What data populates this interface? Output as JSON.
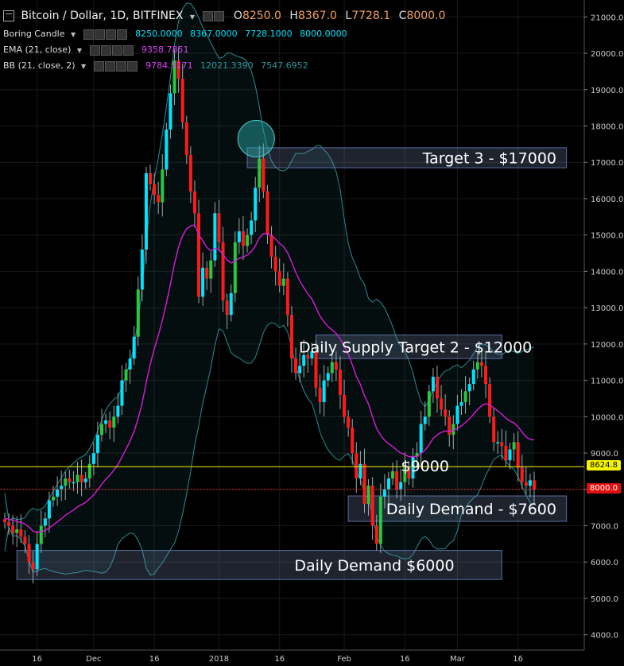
{
  "header": {
    "symbol": "Bitcoin / Dollar, 1D, BITFINEX",
    "o_label": "O",
    "o": "8250.0",
    "h_label": "H",
    "h": "8367.0",
    "l_label": "L",
    "l": "7728.1",
    "c_label": "C",
    "c": "8000.0"
  },
  "indicators": [
    {
      "name": "Boring Candle",
      "values": [
        "8250.0000",
        "8367.0000",
        "7728.1000",
        "8000.0000"
      ],
      "color": "#00e5ff"
    },
    {
      "name": "EMA (21, close)",
      "values": [
        "9358.7851"
      ],
      "color": "#e040fb"
    },
    {
      "name": "BB (21, close, 2)",
      "values": [
        "9784.5171",
        "12021.3390",
        "7547.6952"
      ],
      "colors": [
        "#e040fb",
        "#2a9aa0",
        "#2a9aa0"
      ]
    }
  ],
  "price_labels": {
    "hline": "8624.8",
    "last": "8000.0"
  },
  "colors": {
    "up": "#00e5ff",
    "up_alt": "#26c940",
    "down": "#ff1a1a",
    "ema": "#d81bd8",
    "bb": "#2a8a90",
    "hline": "#f5f500",
    "box": "#5a6ea0"
  },
  "chart_data": {
    "type": "candlestick",
    "title": "Bitcoin / Dollar, 1D, BITFINEX",
    "ylim": [
      3600,
      21400
    ],
    "yticks": [
      4000,
      5000,
      6000,
      7000,
      8000,
      9000,
      10000,
      11000,
      12000,
      13000,
      14000,
      15000,
      16000,
      17000,
      18000,
      19000,
      20000,
      21000
    ],
    "ytick_labels": [
      "4000.0",
      "5000.0",
      "6000.0",
      "7000.0",
      "8000.0",
      "9000.0",
      "10000.0",
      "11000.0",
      "12000.0",
      "13000.0",
      "14000.0",
      "15000.0",
      "16000.0",
      "17000.0",
      "18000.0",
      "19000.0",
      "20000.0",
      "21000.0"
    ],
    "xticks": [
      {
        "label": "16",
        "bar": 8
      },
      {
        "label": "Dec",
        "bar": 22
      },
      {
        "label": "16",
        "bar": 37
      },
      {
        "label": "2018",
        "bar": 53
      },
      {
        "label": "16",
        "bar": 68
      },
      {
        "label": "Feb",
        "bar": 84
      },
      {
        "label": "16",
        "bar": 99
      },
      {
        "label": "Mar",
        "bar": 112
      },
      {
        "label": "16",
        "bar": 127
      }
    ],
    "series_close": [
      7100,
      7000,
      6800,
      6900,
      6700,
      6500,
      6000,
      5800,
      6500,
      7000,
      7200,
      7700,
      7800,
      8000,
      8100,
      8300,
      8200,
      8200,
      8400,
      8200,
      8300,
      8700,
      9000,
      9500,
      9800,
      9900,
      9700,
      10000,
      10300,
      11000,
      11300,
      11600,
      12200,
      13500,
      14600,
      16700,
      16400,
      16100,
      15900,
      16800,
      17900,
      18900,
      19800,
      19300,
      18100,
      17200,
      16200,
      15600,
      13300,
      14100,
      13800,
      14300,
      15600,
      14800,
      13200,
      12800,
      13400,
      14800,
      15100,
      14700,
      15000,
      15400,
      16300,
      17100,
      16200,
      15000,
      14400,
      14000,
      13600,
      13800,
      12800,
      11600,
      11200,
      11400,
      11700,
      11600,
      11800,
      10800,
      10400,
      11000,
      11200,
      11500,
      11300,
      10600,
      10000,
      9700,
      9000,
      8300,
      8700,
      7600,
      8100,
      7000,
      6500,
      7800,
      8000,
      8300,
      8500,
      8000,
      8200,
      8600,
      8300,
      8900,
      9000,
      9800,
      10000,
      10700,
      11100,
      10500,
      10200,
      10000,
      9500,
      9800,
      10300,
      10400,
      10700,
      10900,
      11300,
      11500,
      11400,
      10900,
      10000,
      9300,
      9300,
      9200,
      8800,
      9100,
      9300,
      8600,
      8200,
      8100,
      8250,
      8000
    ],
    "ema": [
      7200,
      7180,
      7150,
      7120,
      7090,
      7050,
      6960,
      6850,
      6820,
      6840,
      6870,
      6940,
      7020,
      7110,
      7190,
      7290,
      7360,
      7430,
      7520,
      7580,
      7640,
      7740,
      7850,
      7990,
      8140,
      8280,
      8390,
      8530,
      8680,
      8890,
      9110,
      9330,
      9590,
      9950,
      10370,
      10940,
      11440,
      11870,
      12240,
      12650,
      13130,
      13650,
      14210,
      14670,
      14980,
      15170,
      15250,
      15280,
      15010,
      14840,
      14660,
      14560,
      14630,
      14600,
      14470,
      14310,
      14230,
      14280,
      14360,
      14390,
      14450,
      14540,
      14700,
      14920,
      15040,
      15040,
      14980,
      14890,
      14770,
      14680,
      14510,
      14250,
      13970,
      13740,
      13550,
      13380,
      13240,
      13010,
      12770,
      12610,
      12480,
      12390,
      12290,
      12140,
      11940,
      11720,
      11430,
      11110,
      10890,
      10580,
      10350,
      10000,
      9680,
      9490,
      9350,
      9250,
      9180,
      9080,
      9000,
      8960,
      8900,
      8900,
      8910,
      8990,
      9080,
      9230,
      9400,
      9500,
      9570,
      9610,
      9600,
      9620,
      9680,
      9750,
      9840,
      9940,
      10070,
      10200,
      10300,
      10360,
      10330,
      10240,
      10160,
      10070,
      9960,
      9880,
      9830,
      9720,
      9580,
      9440,
      9380,
      9359
    ],
    "boxes": [
      {
        "label": "Target 3 - $17000",
        "bar0": 60,
        "bar1": 139,
        "top": 17400,
        "bottom": 16850
      },
      {
        "label": "Daily Supply Target 2 - $12000",
        "bar0": 77,
        "bar1": 123,
        "top": 12250,
        "bottom": 11600
      },
      {
        "label": "Daily Demand - $7600",
        "bar0": 85,
        "bar1": 139,
        "top": 7820,
        "bottom": 7120
      },
      {
        "label": "Daily Demand $6000",
        "bar0": 3,
        "bar1": 123,
        "top": 6320,
        "bottom": 5520
      }
    ],
    "annotations": [
      {
        "label": "$9000",
        "bar": 104,
        "y": 8650
      }
    ],
    "hline": 8624.8
  }
}
